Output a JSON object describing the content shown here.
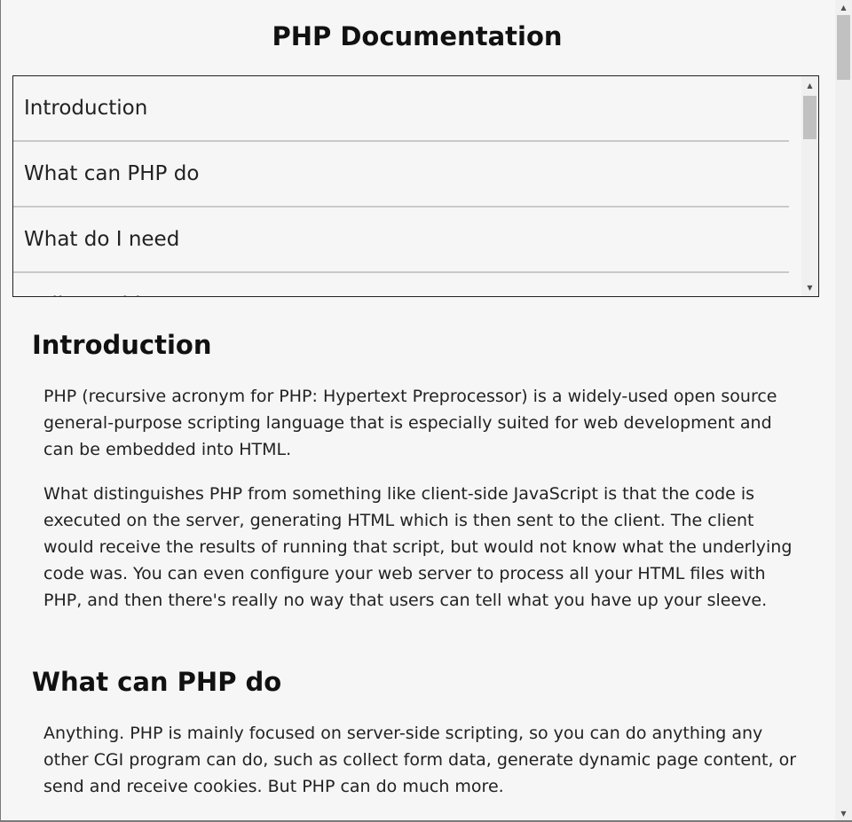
{
  "page": {
    "title": "PHP Documentation"
  },
  "nav": {
    "items": [
      {
        "label": "Introduction"
      },
      {
        "label": "What can PHP do"
      },
      {
        "label": "What do I need"
      },
      {
        "label": "Hello World"
      }
    ]
  },
  "sections": [
    {
      "heading": "Introduction",
      "paragraphs": [
        "PHP (recursive acronym for PHP: Hypertext Preprocessor) is a widely-used open source general-purpose scripting language that is especially suited for web development and can be embedded into HTML.",
        "What distinguishes PHP from something like client-side JavaScript is that the code is executed on the server, generating HTML which is then sent to the client. The client would receive the results of running that script, but would not know what the underlying code was. You can even configure your web server to process all your HTML files with PHP, and then there's really no way that users can tell what you have up your sleeve."
      ]
    },
    {
      "heading": "What can PHP do",
      "paragraphs": [
        "Anything. PHP is mainly focused on server-side scripting, so you can do anything any other CGI program can do, such as collect form data, generate dynamic page content, or send and receive cookies. But PHP can do much more."
      ]
    }
  ],
  "icons": {
    "scroll_up": "triangle-up",
    "scroll_down": "triangle-down"
  }
}
